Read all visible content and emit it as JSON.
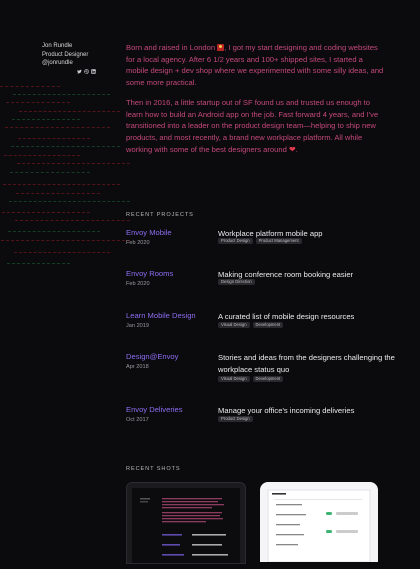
{
  "profile": {
    "name": "Jon Rundle",
    "role": "Product Designer",
    "handle": "@jonrundle",
    "social_icons": [
      "twitter-icon",
      "dribbble-icon",
      "linkedin-icon"
    ]
  },
  "bio": {
    "p1_before_flag": "Born and raised in London ",
    "p1_after_flag": ", I got my start designing and coding websites for a local agency. After 6 1/2 years and 100+ shipped sites, I started a mobile design + dev shop where we experimented with some silly ideas, and some more practical.",
    "p2_before_heart": "Then in 2016, a little startup out of SF found us and trusted us enough to learn how to build an Android app on the job. Fast forward 4 years, and I've transitioned into a leader on the product design team—helping to ship new products, and most recently, a brand new workplace platform. All while working with some of the best designers around ",
    "p2_end": "."
  },
  "colors": {
    "background": "#0b0b0d",
    "bio_text": "#c4487c",
    "project_link": "#8d6df2",
    "tag_bg": "#2a2a2e"
  },
  "projects_section": {
    "title": "RECENT PROJECTS",
    "items": [
      {
        "name": "Envoy Mobile",
        "date": "Feb 2020",
        "description": "Workplace platform mobile app",
        "tags": [
          "Product Design",
          "Product Management"
        ]
      },
      {
        "name": "Envoy Rooms",
        "date": "Feb 2020",
        "description": "Making conference room booking easier",
        "tags": [
          "Design Direction"
        ]
      },
      {
        "name": "Learn Mobile Design",
        "date": "Jan 2019",
        "description": "A curated list of mobile design resources",
        "tags": [
          "Visual Design",
          "Development"
        ]
      },
      {
        "name": "Design@Envoy",
        "date": "Apr 2018",
        "description": "Stories and ideas from the designers challenging the workplace status quo",
        "tags": [
          "Visual Design",
          "Development"
        ]
      },
      {
        "name": "Envoy Deliveries",
        "date": "Oct 2017",
        "description": "Manage your office's incoming deliveries",
        "tags": [
          "Product Design"
        ]
      }
    ]
  },
  "shots_section": {
    "title": "RECENT SHOTS"
  }
}
